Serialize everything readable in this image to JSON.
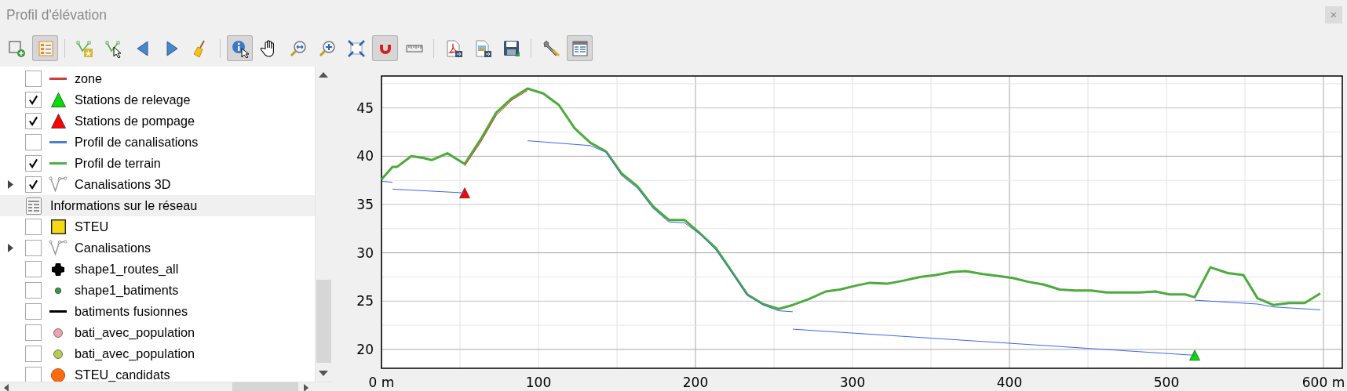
{
  "window": {
    "title": "Profil d'élévation",
    "close": "×"
  },
  "toolbar": [
    {
      "kind": "add-layer",
      "active": false
    },
    {
      "kind": "legend",
      "active": true
    },
    {
      "kind": "separator"
    },
    {
      "kind": "vertex-star",
      "active": false
    },
    {
      "kind": "vertex-select",
      "active": false
    },
    {
      "kind": "back",
      "active": false
    },
    {
      "kind": "forward",
      "active": false
    },
    {
      "kind": "broom",
      "active": false
    },
    {
      "kind": "separator"
    },
    {
      "kind": "identify",
      "active": true
    },
    {
      "kind": "pan",
      "active": false
    },
    {
      "kind": "zoom-full",
      "active": false
    },
    {
      "kind": "zoom-in",
      "active": false
    },
    {
      "kind": "zoom-extent",
      "active": false
    },
    {
      "kind": "magnet",
      "active": true
    },
    {
      "kind": "ruler",
      "active": false
    },
    {
      "kind": "separator"
    },
    {
      "kind": "pdf",
      "active": false
    },
    {
      "kind": "image",
      "active": false
    },
    {
      "kind": "save",
      "active": false
    },
    {
      "kind": "separator"
    },
    {
      "kind": "wrench",
      "active": false
    },
    {
      "kind": "table",
      "active": true
    }
  ],
  "layers": [
    {
      "label": "zone",
      "kind": "line",
      "color": "#d03b3b",
      "checked": false,
      "has_children": false,
      "selected": false
    },
    {
      "label": "Stations de relevage",
      "kind": "triangle",
      "color": "#00e000",
      "checked": true,
      "has_children": false,
      "selected": false
    },
    {
      "label": "Stations de pompage",
      "kind": "triangle",
      "color": "#ff0000",
      "checked": true,
      "has_children": false,
      "selected": false
    },
    {
      "label": "Profil de canalisations",
      "kind": "line",
      "color": "#4a7fd0",
      "checked": false,
      "has_children": false,
      "selected": false
    },
    {
      "label": "Profil de terrain",
      "kind": "line",
      "color": "#4cb04c",
      "checked": true,
      "has_children": false,
      "selected": false
    },
    {
      "label": "Canalisations 3D",
      "kind": "vertex",
      "color": "#909090",
      "checked": true,
      "has_children": true,
      "selected": false
    },
    {
      "label": "Informations sur le réseau",
      "kind": "table",
      "color": "#909090",
      "has_children": false,
      "selected": true
    },
    {
      "label": "STEU",
      "kind": "square",
      "color": "#f5d916",
      "checked": false,
      "has_children": false,
      "selected": false
    },
    {
      "label": "Canalisations",
      "kind": "vertex",
      "color": "#909090",
      "checked": false,
      "has_children": true,
      "selected": false
    },
    {
      "label": "shape1_routes_all",
      "kind": "cross",
      "color": "#000000",
      "checked": false,
      "has_children": false,
      "selected": false
    },
    {
      "label": "shape1_batiments",
      "kind": "dot",
      "color": "#3a9a3a",
      "checked": false,
      "has_children": false,
      "selected": false
    },
    {
      "label": "batiments fusionnes",
      "kind": "line",
      "color": "#000000",
      "checked": false,
      "has_children": false,
      "selected": false
    },
    {
      "label": "bati_avec_population",
      "kind": "circle",
      "color": "#f0a0b0",
      "checked": false,
      "has_children": false,
      "selected": false
    },
    {
      "label": "bati_avec_population",
      "kind": "circle",
      "color": "#b8cc50",
      "checked": false,
      "has_children": false,
      "selected": false
    },
    {
      "label": "STEU_candidats",
      "kind": "big-circle",
      "color": "#ff6a10",
      "checked": false,
      "has_children": false,
      "selected": false
    }
  ],
  "chart": {
    "chart_data": {
      "type": "line",
      "xlim": [
        0,
        612
      ],
      "ylim": [
        18.05,
        48.3
      ],
      "xticks": [
        {
          "value": 0,
          "label": "0 m"
        },
        100,
        200,
        300,
        400,
        500,
        {
          "value": 600,
          "label": "600 m"
        }
      ],
      "yticks": [
        20,
        25,
        30,
        35,
        40,
        45
      ],
      "grid": true,
      "series": [
        {
          "color": "#4cab3c",
          "x": [
            0,
            7,
            10,
            19,
            27,
            32,
            42,
            53,
            63,
            73,
            83,
            93,
            103,
            113,
            123,
            133,
            143,
            153,
            163,
            173,
            183,
            193,
            203,
            213,
            223,
            233,
            243,
            253,
            262,
            272,
            283,
            292,
            302,
            311,
            322,
            332,
            343,
            353,
            363,
            372,
            383,
            393,
            402,
            412,
            422,
            432,
            442,
            452,
            462,
            472,
            483,
            493,
            502,
            512,
            518,
            528,
            539,
            549,
            558,
            568,
            578,
            588,
            598
          ],
          "values": [
            37.6,
            38.9,
            38.9,
            40,
            39.8,
            39.6,
            40.3,
            39.2,
            41.7,
            44.5,
            46,
            47,
            46.5,
            45.3,
            42.9,
            41.4,
            40.5,
            38.2,
            36.9,
            34.8,
            33.4,
            33.4,
            32,
            30.5,
            28.1,
            25.7,
            24.7,
            24.2,
            24.6,
            25.2,
            26,
            26.2,
            26.6,
            26.9,
            26.8,
            27.1,
            27.5,
            27.7,
            28,
            28.1,
            27.8,
            27.6,
            27.4,
            27,
            26.7,
            26.2,
            26.1,
            26.1,
            25.9,
            25.9,
            25.9,
            26,
            25.7,
            25.7,
            25.4,
            28.5,
            27.9,
            27.7,
            25.3,
            24.6,
            24.8,
            24.8,
            25.8
          ]
        },
        {
          "color": "#3a66ee",
          "x": [
            0,
            7
          ],
          "values": [
            37.4,
            37.3
          ]
        },
        {
          "color": "#3a66ee",
          "x": [
            7,
            53
          ],
          "values": [
            36.6,
            36.2
          ]
        },
        {
          "color": "#3a66ee",
          "x": [
            93,
            133,
            143,
            153,
            163,
            173,
            183,
            193,
            203,
            213,
            223,
            233,
            243,
            253,
            262
          ],
          "values": [
            41.6,
            41.1,
            40.4,
            38,
            36.7,
            34.6,
            33.2,
            33.1,
            31.9,
            30.3,
            28,
            25.6,
            24.6,
            24,
            23.9
          ]
        },
        {
          "color": "#3a66ee",
          "x": [
            262,
            518
          ],
          "values": [
            22.1,
            19.4
          ]
        },
        {
          "color": "#3a66ee",
          "x": [
            518,
            558,
            568,
            598
          ],
          "values": [
            25.1,
            24.7,
            24.4,
            24.1
          ]
        },
        {
          "color": "#e03020",
          "x": [
            53,
            63,
            73,
            83,
            93
          ],
          "values": [
            39,
            41.4,
            44.2,
            45.8,
            46.8
          ]
        },
        {
          "color": "#ff0000",
          "marker": "triangle",
          "x": [
            53
          ],
          "values": [
            36.2
          ]
        },
        {
          "color": "#00e000",
          "marker": "triangle",
          "x": [
            518
          ],
          "values": [
            19.4
          ]
        }
      ]
    }
  }
}
